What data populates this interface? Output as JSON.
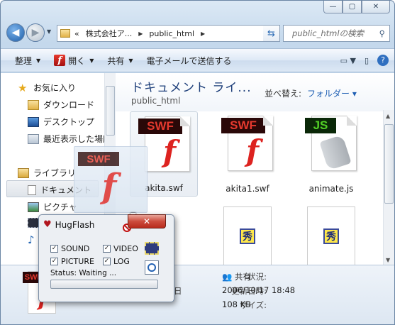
{
  "window": {
    "caption_buttons": [
      "—",
      "▢",
      "✕"
    ]
  },
  "navbar": {
    "address_segments": [
      "«",
      "株式会社ア...",
      "public_html"
    ],
    "search_placeholder": "public_htmlの検索"
  },
  "toolbar": {
    "organize": "整理",
    "open": "開く",
    "share": "共有",
    "email": "電子メールで送信する"
  },
  "sidebar": {
    "favorites": "お気に入り",
    "downloads": "ダウンロード",
    "desktop": "デスクトップ",
    "recent": "最近表示した場所",
    "libraries": "ライブラリ",
    "documents": "ドキュメント",
    "pictures": "ピクチャ"
  },
  "main": {
    "library_title": "ドキュメント ライ...",
    "library_path": "public_html",
    "arrange_label": "並べ替え:",
    "arrange_value": "フォルダー ▾",
    "files": [
      {
        "name": "akita.swf",
        "type": "swf"
      },
      {
        "name": "akita1.swf",
        "type": "swf"
      },
      {
        "name": "animate.js",
        "type": "js"
      }
    ],
    "thumb_glyph": "秀"
  },
  "details": {
    "status_label": "状況:",
    "status_value": "共有",
    "modified_label": "更新日時:",
    "modified_value": "2006/10/17 18:48",
    "size_label": "サイズ:",
    "size_value": "108 KB",
    "date_partial": "日"
  },
  "drag_ghost": {
    "band": "SWF"
  },
  "hugflash": {
    "title": "HugFlash",
    "close": "✕",
    "options": [
      {
        "label": "SOUND",
        "checked": true
      },
      {
        "label": "VIDEO",
        "checked": true
      },
      {
        "label": "PICTURE",
        "checked": true
      },
      {
        "label": "LOG",
        "checked": true
      }
    ],
    "status": "Status: Waiting ...",
    "progress": 0
  },
  "icons": {
    "band_swf": "SWF",
    "band_js": "JS",
    "flash_glyph": "f"
  }
}
